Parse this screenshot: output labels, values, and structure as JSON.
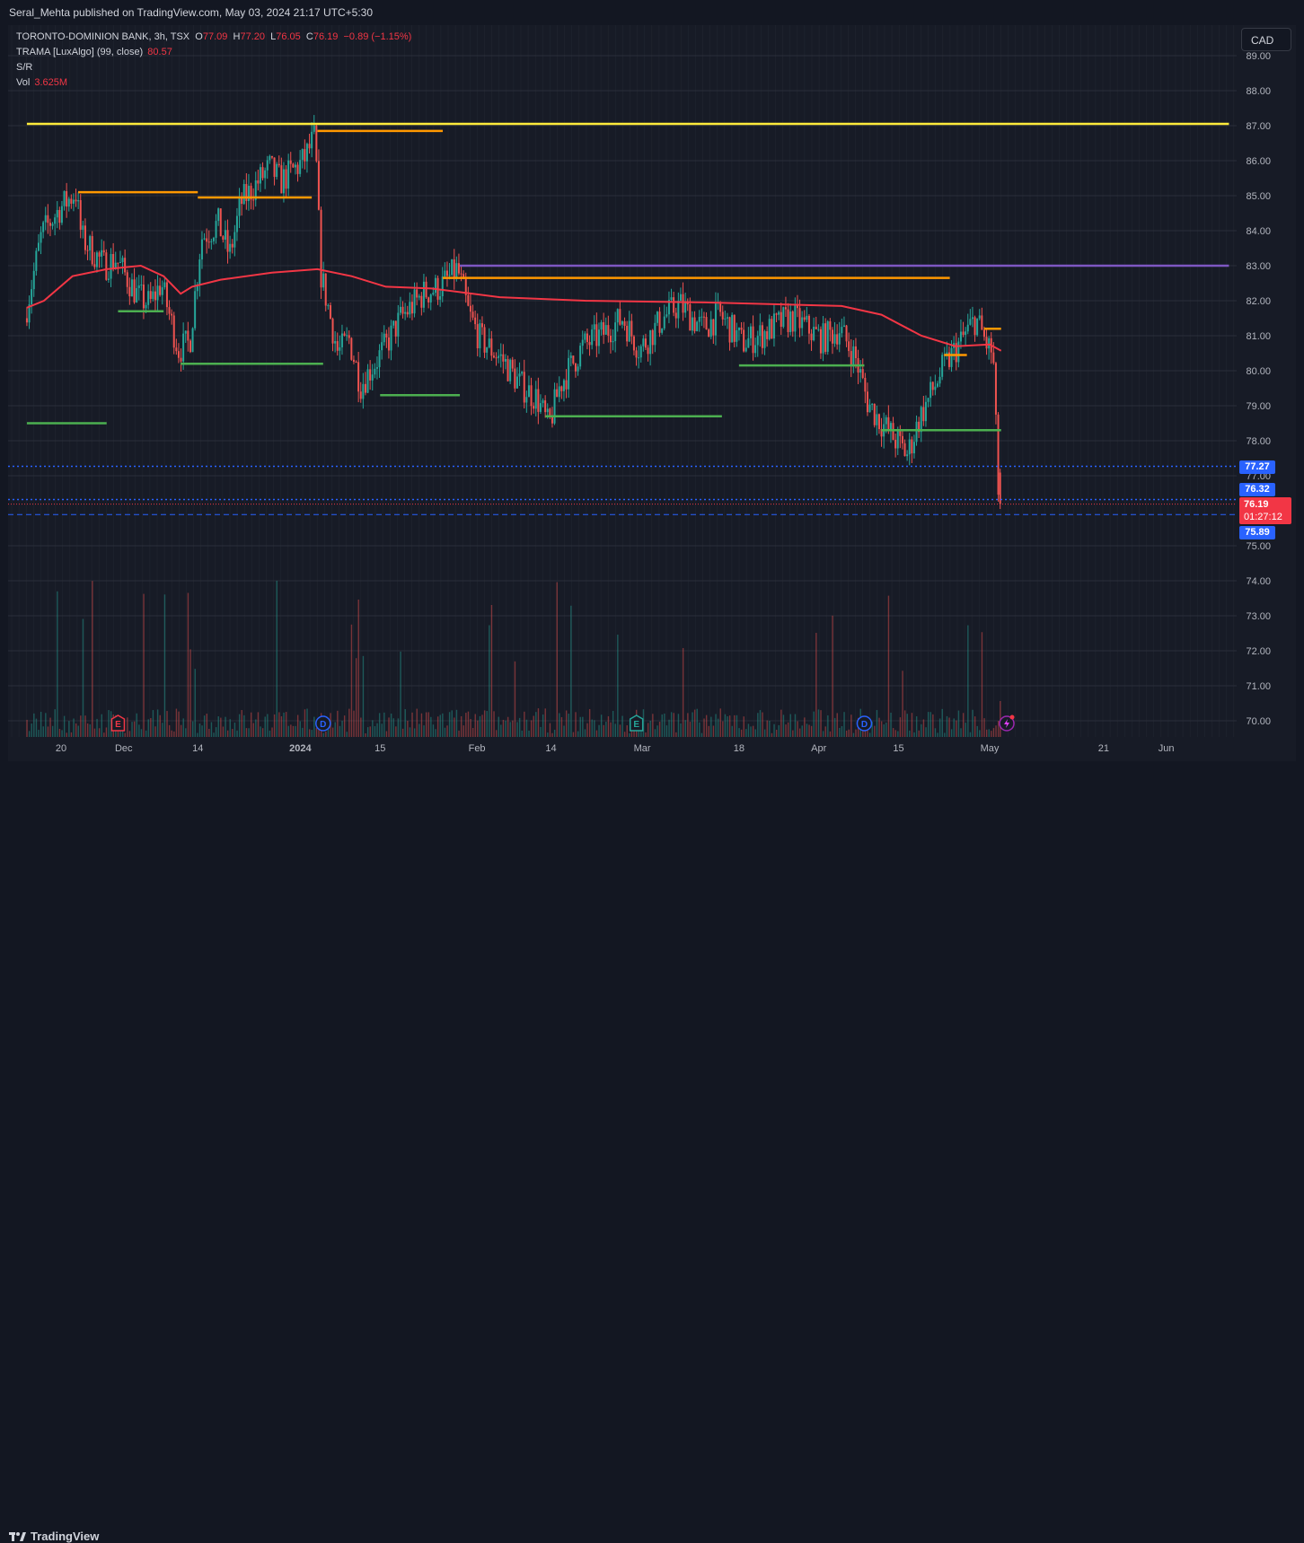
{
  "publisher": "Seral_Mehta published on TradingView.com, May 03, 2024 21:17 UTC+5:30",
  "legend": {
    "symbol": "TORONTO-DOMINION BANK, 3h, TSX",
    "open_label": "O",
    "open": "77.09",
    "high_label": "H",
    "high": "77.20",
    "low_label": "L",
    "low": "76.05",
    "close_label": "C",
    "close": "76.19",
    "change": "−0.89 (−1.15%)",
    "indicator1_name": "TRAMA [LuxAlgo] (99, close)",
    "indicator1_value": "80.57",
    "indicator2_name": "S/R",
    "vol_label": "Vol",
    "vol_value": "3.625M"
  },
  "currency": "CAD",
  "price_tags": {
    "tag1": "77.27",
    "tag2": "76.32",
    "last_price": "76.19",
    "countdown": "01:27:12",
    "tag3": "75.89"
  },
  "brand": "TradingView",
  "colors": {
    "up": "#26a69a",
    "down": "#ef5350",
    "trama": "#f23645",
    "resistance": "#ff9800",
    "support": "#4caf50",
    "yellow_level": "#ffeb3b",
    "purple_level": "#7e57c2",
    "blue_dots": "#2962ff"
  },
  "chart_data": {
    "type": "candlestick",
    "y_axis": {
      "ticks": [
        "89.00",
        "88.00",
        "87.00",
        "86.00",
        "85.00",
        "84.00",
        "83.00",
        "82.00",
        "81.00",
        "80.00",
        "79.00",
        "78.00",
        "77.00",
        "75.00",
        "74.00",
        "73.00",
        "72.00",
        "71.00",
        "70.00"
      ],
      "range": [
        69.6,
        89.2
      ]
    },
    "x_axis": {
      "ticks": [
        "20",
        "Dec",
        "14",
        "2024",
        "15",
        "Feb",
        "14",
        "Mar",
        "18",
        "Apr",
        "15",
        "May",
        "21",
        "Jun"
      ]
    },
    "path": [
      [
        "2023-11-14",
        81.5
      ],
      [
        "2023-11-17",
        83.9
      ],
      [
        "2023-11-20",
        84.6
      ],
      [
        "2023-11-23",
        85.1
      ],
      [
        "2023-11-24",
        83.8
      ],
      [
        "2023-11-28",
        83.0
      ],
      [
        "2023-11-30",
        83.2
      ],
      [
        "2023-12-04",
        82.1
      ],
      [
        "2023-12-06",
        81.9
      ],
      [
        "2023-12-08",
        82.5
      ],
      [
        "2023-12-11",
        80.6
      ],
      [
        "2023-12-13",
        80.8
      ],
      [
        "2023-12-15",
        83.8
      ],
      [
        "2023-12-18",
        84.2
      ],
      [
        "2023-12-20",
        83.3
      ],
      [
        "2023-12-22",
        84.8
      ],
      [
        "2023-12-27",
        85.8
      ],
      [
        "2023-12-29",
        85.4
      ],
      [
        "2024-01-02",
        86.0
      ],
      [
        "2024-01-04",
        86.7
      ],
      [
        "2024-01-05",
        82.8
      ],
      [
        "2024-01-08",
        80.5
      ],
      [
        "2024-01-10",
        80.9
      ],
      [
        "2024-01-12",
        79.6
      ],
      [
        "2024-01-16",
        80.6
      ],
      [
        "2024-01-19",
        81.5
      ],
      [
        "2024-01-23",
        82.2
      ],
      [
        "2024-01-26",
        82.4
      ],
      [
        "2024-01-29",
        82.9
      ],
      [
        "2024-01-31",
        81.6
      ],
      [
        "2024-02-02",
        80.9
      ],
      [
        "2024-02-06",
        80.3
      ],
      [
        "2024-02-09",
        79.6
      ],
      [
        "2024-02-12",
        79.2
      ],
      [
        "2024-02-14",
        78.4
      ],
      [
        "2024-02-16",
        79.6
      ],
      [
        "2024-02-20",
        80.7
      ],
      [
        "2024-02-23",
        81.0
      ],
      [
        "2024-02-27",
        81.5
      ],
      [
        "2024-03-01",
        80.6
      ],
      [
        "2024-03-05",
        81.5
      ],
      [
        "2024-03-08",
        81.9
      ],
      [
        "2024-03-12",
        81.2
      ],
      [
        "2024-03-15",
        81.6
      ],
      [
        "2024-03-19",
        80.8
      ],
      [
        "2024-03-22",
        81.0
      ],
      [
        "2024-03-26",
        81.4
      ],
      [
        "2024-03-28",
        81.5
      ],
      [
        "2024-04-02",
        80.9
      ],
      [
        "2024-04-05",
        81.2
      ],
      [
        "2024-04-08",
        80.3
      ],
      [
        "2024-04-10",
        79.1
      ],
      [
        "2024-04-12",
        78.6
      ],
      [
        "2024-04-15",
        78.0
      ],
      [
        "2024-04-17",
        77.6
      ],
      [
        "2024-04-19",
        78.6
      ],
      [
        "2024-04-23",
        80.0
      ],
      [
        "2024-04-25",
        80.5
      ],
      [
        "2024-04-29",
        81.5
      ],
      [
        "2024-05-01",
        80.7
      ],
      [
        "2024-05-02",
        80.5
      ],
      [
        "2024-05-03",
        76.19
      ]
    ],
    "trama": [
      [
        "2023-11-14",
        81.8
      ],
      [
        "2023-11-17",
        82.0
      ],
      [
        "2023-11-22",
        82.7
      ],
      [
        "2023-11-28",
        82.9
      ],
      [
        "2023-12-04",
        83.0
      ],
      [
        "2023-12-08",
        82.7
      ],
      [
        "2023-12-11",
        82.2
      ],
      [
        "2023-12-13",
        82.4
      ],
      [
        "2023-12-18",
        82.6
      ],
      [
        "2023-12-27",
        82.8
      ],
      [
        "2024-01-04",
        82.9
      ],
      [
        "2024-01-10",
        82.7
      ],
      [
        "2024-01-16",
        82.4
      ],
      [
        "2024-01-24",
        82.35
      ],
      [
        "2024-02-05",
        82.1
      ],
      [
        "2024-02-20",
        82.0
      ],
      [
        "2024-03-12",
        81.95
      ],
      [
        "2024-04-05",
        81.85
      ],
      [
        "2024-04-12",
        81.6
      ],
      [
        "2024-04-19",
        81.0
      ],
      [
        "2024-04-25",
        80.7
      ],
      [
        "2024-05-01",
        80.75
      ],
      [
        "2024-05-03",
        80.57
      ]
    ],
    "levels": [
      {
        "kind": "yellow",
        "price": 87.05,
        "from": "2023-11-14",
        "to": "2024-06-12"
      },
      {
        "kind": "purple",
        "price": 83.0,
        "from": "2024-01-29",
        "to": "2024-06-12"
      },
      {
        "kind": "resistance",
        "price": 86.85,
        "from": "2024-01-04",
        "to": "2024-01-26"
      },
      {
        "kind": "resistance",
        "price": 85.1,
        "from": "2023-11-23",
        "to": "2023-12-14"
      },
      {
        "kind": "resistance",
        "price": 84.95,
        "from": "2023-12-14",
        "to": "2024-01-03"
      },
      {
        "kind": "resistance",
        "price": 82.65,
        "from": "2024-01-26",
        "to": "2024-04-24"
      },
      {
        "kind": "resistance",
        "price": 81.2,
        "from": "2024-04-30",
        "to": "2024-05-03"
      },
      {
        "kind": "resistance",
        "price": 80.45,
        "from": "2024-04-23",
        "to": "2024-04-27"
      },
      {
        "kind": "support",
        "price": 81.7,
        "from": "2023-11-30",
        "to": "2023-12-08"
      },
      {
        "kind": "support",
        "price": 80.2,
        "from": "2023-12-11",
        "to": "2024-01-05"
      },
      {
        "kind": "support",
        "price": 79.3,
        "from": "2024-01-15",
        "to": "2024-01-29"
      },
      {
        "kind": "support",
        "price": 78.5,
        "from": "2023-11-14",
        "to": "2023-11-28"
      },
      {
        "kind": "support",
        "price": 78.7,
        "from": "2024-02-13",
        "to": "2024-03-15"
      },
      {
        "kind": "support",
        "price": 80.15,
        "from": "2024-03-18",
        "to": "2024-04-09"
      },
      {
        "kind": "support",
        "price": 78.3,
        "from": "2024-04-12",
        "to": "2024-05-03"
      }
    ],
    "dotted_lines": [
      77.27,
      76.32
    ],
    "dashed_lines": [
      75.89
    ],
    "events": [
      {
        "label": "E",
        "date": "2023-11-30",
        "color": "#f23645"
      },
      {
        "label": "D",
        "date": "2024-01-05",
        "color": "#2962ff"
      },
      {
        "label": "E",
        "date": "2024-02-29",
        "color": "#26a69a"
      },
      {
        "label": "D",
        "date": "2024-04-09",
        "color": "#2962ff"
      }
    ]
  }
}
